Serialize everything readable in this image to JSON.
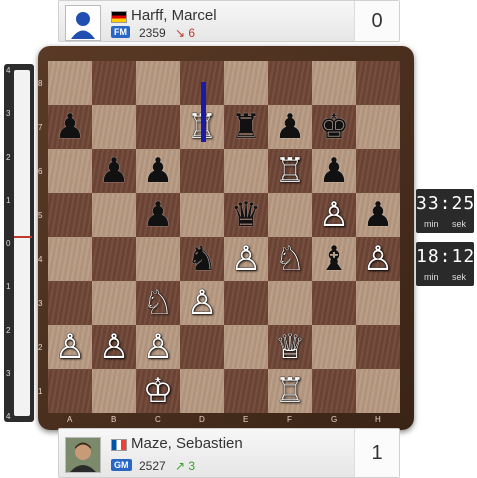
{
  "top_player": {
    "name": "Harff, Marcel",
    "title": "FM",
    "rating": "2359",
    "rating_change": "↘ 6",
    "score": "0",
    "flag": "de",
    "avatar": "silhouette-avatar"
  },
  "bottom_player": {
    "name": "Maze, Sebastien",
    "title": "GM",
    "rating": "2527",
    "rating_change": "↗ 3",
    "score": "1",
    "flag": "fr",
    "avatar": "photo-avatar"
  },
  "clocks": {
    "top": {
      "time": "33:25",
      "min_label": "min",
      "sek_label": "sek"
    },
    "bottom": {
      "time": "18:12",
      "min_label": "min",
      "sek_label": "sek"
    }
  },
  "board": {
    "files": [
      "A",
      "B",
      "C",
      "D",
      "E",
      "F",
      "G",
      "H"
    ],
    "ranks": [
      "8",
      "7",
      "6",
      "5",
      "4",
      "3",
      "2",
      "1"
    ],
    "pieces": [
      {
        "square": "a7",
        "type": "pawn",
        "color": "black"
      },
      {
        "square": "d7",
        "type": "rook",
        "color": "white"
      },
      {
        "square": "e7",
        "type": "rook",
        "color": "black"
      },
      {
        "square": "f7",
        "type": "pawn",
        "color": "black"
      },
      {
        "square": "g7",
        "type": "king",
        "color": "black"
      },
      {
        "square": "b6",
        "type": "pawn",
        "color": "black"
      },
      {
        "square": "c6",
        "type": "pawn",
        "color": "black"
      },
      {
        "square": "f6",
        "type": "rook",
        "color": "white"
      },
      {
        "square": "g6",
        "type": "pawn",
        "color": "black"
      },
      {
        "square": "c5",
        "type": "pawn",
        "color": "black"
      },
      {
        "square": "e5",
        "type": "queen",
        "color": "black"
      },
      {
        "square": "g5",
        "type": "pawn",
        "color": "white"
      },
      {
        "square": "h5",
        "type": "pawn",
        "color": "black"
      },
      {
        "square": "d4",
        "type": "knight",
        "color": "black"
      },
      {
        "square": "e4",
        "type": "pawn",
        "color": "white"
      },
      {
        "square": "f4",
        "type": "knight",
        "color": "white"
      },
      {
        "square": "g4",
        "type": "bishop",
        "color": "black"
      },
      {
        "square": "h4",
        "type": "pawn",
        "color": "white"
      },
      {
        "square": "c3",
        "type": "knight",
        "color": "white"
      },
      {
        "square": "d3",
        "type": "pawn",
        "color": "white"
      },
      {
        "square": "a2",
        "type": "pawn",
        "color": "white"
      },
      {
        "square": "b2",
        "type": "pawn",
        "color": "white"
      },
      {
        "square": "c2",
        "type": "pawn",
        "color": "white"
      },
      {
        "square": "f2",
        "type": "queen",
        "color": "white"
      },
      {
        "square": "c1",
        "type": "king",
        "color": "white"
      },
      {
        "square": "f1",
        "type": "rook",
        "color": "white"
      }
    ],
    "last_move_arrow": {
      "from": "d8",
      "to": "d7",
      "color": "#1a1aaa"
    }
  },
  "eval_bar": {
    "ticks": [
      "4",
      "3",
      "2",
      "1",
      "0",
      "1",
      "2",
      "3",
      "4"
    ],
    "marker_color": "#c0392b"
  },
  "colors": {
    "light_square": "#b89a82",
    "dark_square": "#6e4636",
    "frame": "#4a2e1e",
    "title_badge": "#2a66c4"
  }
}
